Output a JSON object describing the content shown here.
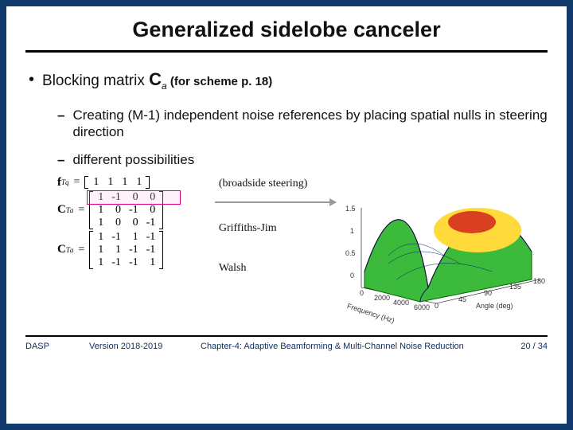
{
  "title": "Generalized sidelobe canceler",
  "b1_prefix": "Blocking matrix ",
  "b1_sym": "C",
  "b1_sub": "a",
  "b1_note": " (for scheme p. 18)",
  "b2a": "Creating (M-1) independent noise references by placing spatial nulls in steering direction",
  "b2b": "different possibilities",
  "matrices": {
    "fq": {
      "lhs": "f",
      "sub": "q",
      "sup": "T",
      "rows": [
        [
          "1",
          "1",
          "1",
          "1"
        ]
      ]
    },
    "gj": {
      "lhs": "C",
      "sub": "a",
      "sup": "T",
      "rows": [
        [
          "1",
          "-1",
          "0",
          "0"
        ],
        [
          "1",
          "0",
          "-1",
          "0"
        ],
        [
          "1",
          "0",
          "0",
          "-1"
        ]
      ]
    },
    "walsh": {
      "lhs": "C",
      "sub": "a",
      "sup": "T",
      "rows": [
        [
          "1",
          "-1",
          "1",
          "-1"
        ],
        [
          "1",
          "1",
          "-1",
          "-1"
        ],
        [
          "1",
          "-1",
          "-1",
          "1"
        ]
      ]
    }
  },
  "lbl_broadside": "(broadside steering)",
  "lbl_gj": "Griffiths-Jim",
  "lbl_walsh": "Walsh",
  "plot": {
    "zticks": [
      "1.5",
      "1",
      "0.5",
      "0"
    ],
    "xticks": [
      "0",
      "2000",
      "4000",
      "6000"
    ],
    "yticks": [
      "0",
      "45",
      "90",
      "135",
      "180"
    ],
    "xlabel": "Frequency (Hz)",
    "ylabel": "Angle (deg)"
  },
  "footer": {
    "org": "DASP",
    "version": "Version 2018-2019",
    "chapter": "Chapter-4: Adaptive Beamforming & Multi-Channel Noise Reduction",
    "page": "20 / 34"
  }
}
